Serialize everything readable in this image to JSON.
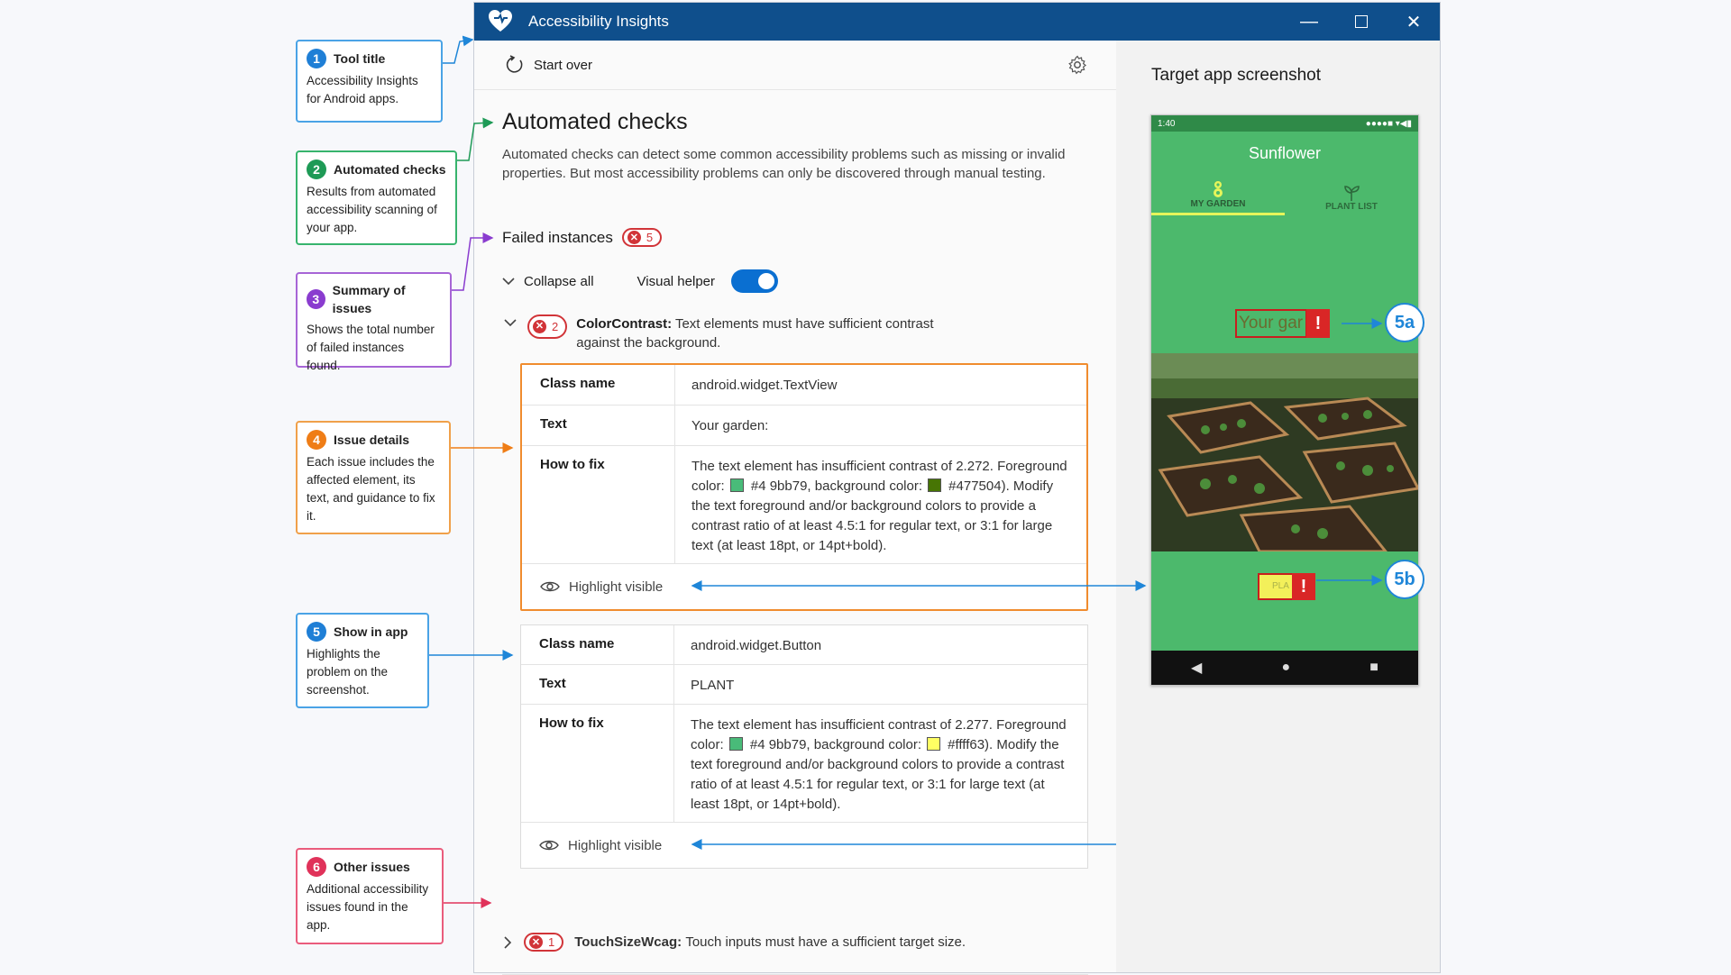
{
  "callouts": [
    {
      "num": "1",
      "title": "Tool title",
      "body": "Accessibility Insights for Android apps."
    },
    {
      "num": "2",
      "title": "Automated checks",
      "body": "Results from automated accessibility scanning of your app."
    },
    {
      "num": "3",
      "title": "Summary of issues",
      "body": "Shows the total number of failed instances found."
    },
    {
      "num": "4",
      "title": "Issue details",
      "body": "Each issue includes the affected element, its text, and guidance to fix it."
    },
    {
      "num": "5",
      "title": "Show in app",
      "body": "Highlights the problem on the screenshot."
    },
    {
      "num": "6",
      "title": "Other issues",
      "body": "Additional accessibility issues found in the app."
    }
  ],
  "window": {
    "title": "Accessibility Insights",
    "start_over": "Start over",
    "heading": "Automated checks",
    "description": "Automated checks can detect some common accessibility problems such as missing or invalid properties. But most accessibility problems can only be discovered through manual testing.",
    "failed_label": "Failed instances",
    "failed_count": "5",
    "collapse_all": "Collapse all",
    "visual_helper": "Visual helper",
    "visual_helper_on": true
  },
  "rule1": {
    "count": "2",
    "name": "ColorContrast:",
    "text": "Text elements must have sufficient contrast against the background."
  },
  "labels": {
    "class_name": "Class name",
    "text": "Text",
    "how_to_fix": "How to fix",
    "highlight": "Highlight visible"
  },
  "card1": {
    "class_name": "android.widget.TextView",
    "text": "Your garden:",
    "fix_a": "The text element has insufficient contrast of 2.272. Foreground color:",
    "fg": "#4 9bb79, background color:",
    "bg": "#477504). Modify the text foreground and/or background colors to provide a contrast ratio of at least 4.5:1 for regular text, or 3:1 for large text (at least 18pt, or 14pt+bold).",
    "fg_color": "#49bb79",
    "bg_color": "#477504"
  },
  "card2": {
    "class_name": "android.widget.Button",
    "text": "PLANT",
    "fix_a": "The text element has insufficient contrast of 2.277. Foreground color:",
    "fg": "#4 9bb79, background color:",
    "bg": "#ffff63). Modify the text foreground and/or background colors to provide a contrast ratio of at least 4.5:1 for regular text, or 3:1 for large text (at least 18pt, or 14pt+bold).",
    "fg_color": "#49bb79",
    "bg_color": "#ffff63"
  },
  "rule2": {
    "count": "1",
    "name": "TouchSizeWcag:",
    "text": "Touch inputs must have a sufficient target size."
  },
  "screenshot": {
    "label": "Target app screenshot",
    "status_time": "1:40",
    "app_name": "Sunflower",
    "tab_garden": "MY GARDEN",
    "tab_plants": "PLANT LIST",
    "your_garden": "Your gar",
    "plant_button": "PLA",
    "marker_a": "5a",
    "marker_b": "5b"
  },
  "colors": {
    "titlebar": "#0f4f8c",
    "accent": "#0a6fd1",
    "error": "#d13438",
    "phone_green": "#4cb96c"
  }
}
